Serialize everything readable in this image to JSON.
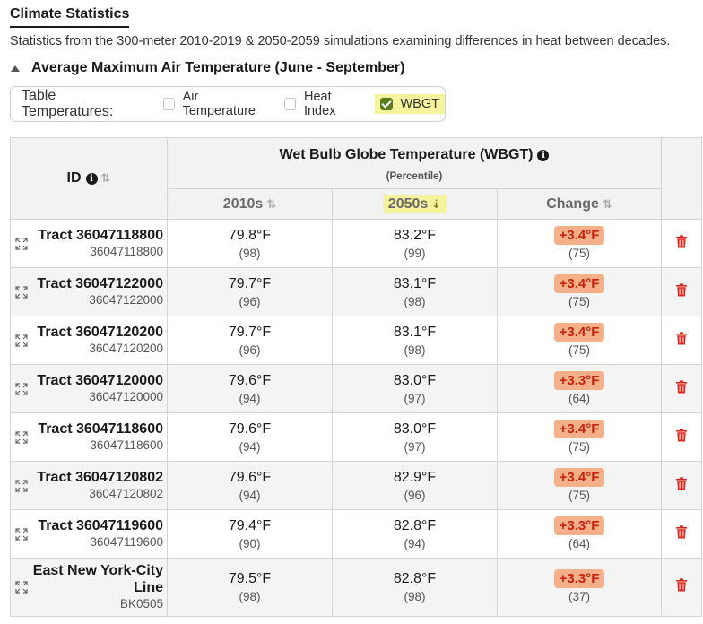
{
  "page": {
    "title": "Climate Statistics",
    "subtitle": "Statistics from the 300-meter 2010-2019 & 2050-2059 simulations examining differences in heat between decades.",
    "section_title": "Average Maximum Air Temperature (June - September)"
  },
  "toggles": {
    "label": "Table Temperatures:",
    "options": [
      {
        "label": "Air Temperature",
        "checked": false
      },
      {
        "label": "Heat Index",
        "checked": false
      },
      {
        "label": "WBGT",
        "checked": true
      }
    ]
  },
  "table": {
    "id_header": "ID",
    "main_header": "Wet Bulb Globe Temperature (WBGT)",
    "main_subheader": "(Percentile)",
    "columns": [
      "2010s",
      "2050s",
      "Change"
    ],
    "sorted_column": "2050s",
    "rows": [
      {
        "name": "Tract 36047118800",
        "code": "36047118800",
        "v2010": "79.8°F",
        "p2010": "(98)",
        "v2050": "83.2°F",
        "p2050": "(99)",
        "change": "+3.4°F",
        "pchange": "(75)"
      },
      {
        "name": "Tract 36047122000",
        "code": "36047122000",
        "v2010": "79.7°F",
        "p2010": "(96)",
        "v2050": "83.1°F",
        "p2050": "(98)",
        "change": "+3.4°F",
        "pchange": "(75)"
      },
      {
        "name": "Tract 36047120200",
        "code": "36047120200",
        "v2010": "79.7°F",
        "p2010": "(96)",
        "v2050": "83.1°F",
        "p2050": "(98)",
        "change": "+3.4°F",
        "pchange": "(75)"
      },
      {
        "name": "Tract 36047120000",
        "code": "36047120000",
        "v2010": "79.6°F",
        "p2010": "(94)",
        "v2050": "83.0°F",
        "p2050": "(97)",
        "change": "+3.3°F",
        "pchange": "(64)"
      },
      {
        "name": "Tract 36047118600",
        "code": "36047118600",
        "v2010": "79.6°F",
        "p2010": "(94)",
        "v2050": "83.0°F",
        "p2050": "(97)",
        "change": "+3.4°F",
        "pchange": "(75)"
      },
      {
        "name": "Tract 36047120802",
        "code": "36047120802",
        "v2010": "79.6°F",
        "p2010": "(94)",
        "v2050": "82.9°F",
        "p2050": "(96)",
        "change": "+3.4°F",
        "pchange": "(75)"
      },
      {
        "name": "Tract 36047119600",
        "code": "36047119600",
        "v2010": "79.4°F",
        "p2010": "(90)",
        "v2050": "82.8°F",
        "p2050": "(94)",
        "change": "+3.3°F",
        "pchange": "(64)"
      },
      {
        "name": "East New York-City Line",
        "code": "BK0505",
        "v2010": "79.5°F",
        "p2010": "(98)",
        "v2050": "82.8°F",
        "p2050": "(98)",
        "change": "+3.3°F",
        "pchange": "(37)"
      }
    ]
  },
  "colors": {
    "accent_highlight": "#f5f39c",
    "change_badge_bg": "#f5b08a",
    "change_badge_text": "#c8230e",
    "trash": "#d8281f",
    "checkbox": "#5a7d1f"
  },
  "icons": {
    "expand": "expand-arrows-icon",
    "delete": "trash-icon",
    "info": "info-icon",
    "sort": "sort-arrows-icon"
  }
}
